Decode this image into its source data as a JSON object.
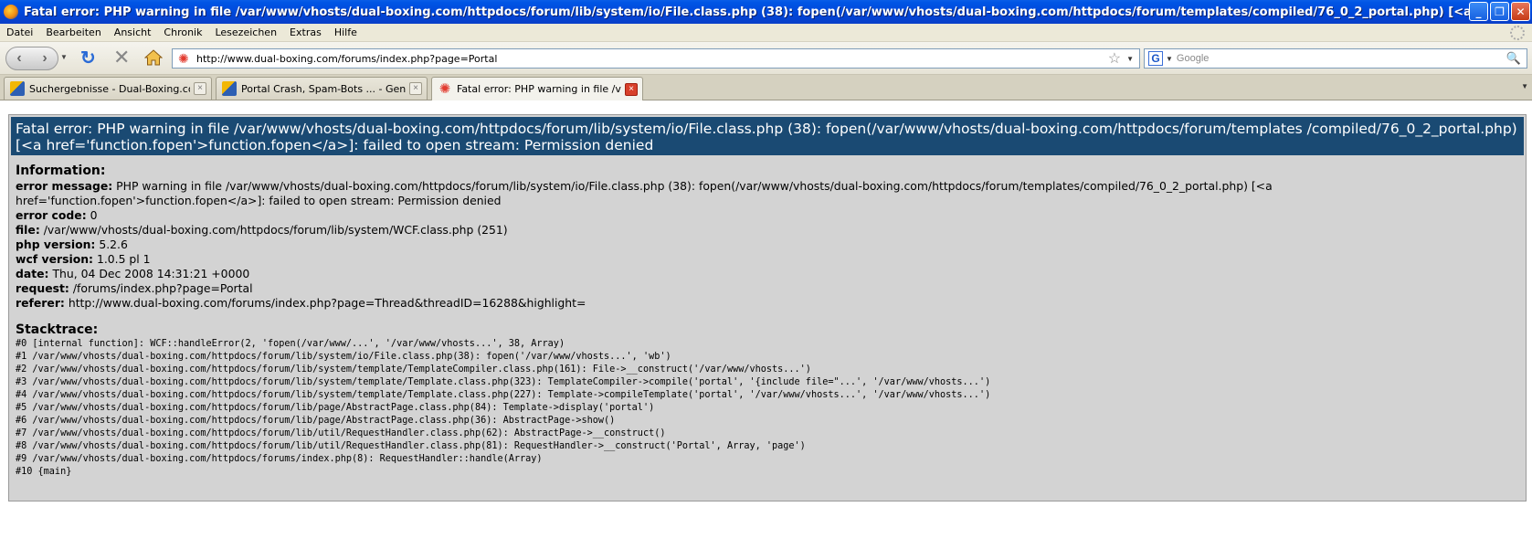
{
  "window": {
    "title": "Fatal error: PHP warning in file /var/www/vhosts/dual-boxing.com/httpdocs/forum/lib/system/io/File.class.php (38): fopen(/var/www/vhosts/dual-boxing.com/httpdocs/forum/templates/compiled/76_0_2_portal.php) [<a href='function.fopen'>function.f...",
    "minimize": "_",
    "maximize": "❐",
    "close": "✕"
  },
  "menu": [
    "Datei",
    "Bearbeiten",
    "Ansicht",
    "Chronik",
    "Lesezeichen",
    "Extras",
    "Hilfe"
  ],
  "nav": {
    "back": "‹",
    "forward": "›",
    "url": "http://www.dual-boxing.com/forums/index.php?page=Portal",
    "search_engine_letter": "G",
    "search_placeholder": "Google"
  },
  "tabs": [
    {
      "label": "Suchergebnisse - Dual-Boxing.com Com...",
      "icon": "wbb-forum-icon",
      "active": false
    },
    {
      "label": "Portal Crash, Spam-Bots ... - General D...",
      "icon": "wbb-forum-icon",
      "active": false
    },
    {
      "label": "Fatal error: PHP warning in file /v...",
      "icon": "error-site-icon",
      "active": true
    }
  ],
  "error": {
    "heading": "Fatal error: PHP warning in file /var/www/vhosts/dual-boxing.com/httpdocs/forum/lib/system/io/File.class.php (38): fopen(/var/www/vhosts/dual-boxing.com/httpdocs/forum/templates /compiled/76_0_2_portal.php) [<a href='function.fopen'>function.fopen</a>]: failed to open stream: Permission denied",
    "info_title": "Information:",
    "fields": [
      {
        "label": "error message:",
        "value": "PHP warning in file /var/www/vhosts/dual-boxing.com/httpdocs/forum/lib/system/io/File.class.php (38): fopen(/var/www/vhosts/dual-boxing.com/httpdocs/forum/templates/compiled/76_0_2_portal.php) [<a href='function.fopen'>function.fopen</a>]: failed to open stream: Permission denied"
      },
      {
        "label": "error code:",
        "value": "0"
      },
      {
        "label": "file:",
        "value": "/var/www/vhosts/dual-boxing.com/httpdocs/forum/lib/system/WCF.class.php (251)"
      },
      {
        "label": "php version:",
        "value": "5.2.6"
      },
      {
        "label": "wcf version:",
        "value": "1.0.5 pl 1"
      },
      {
        "label": "date:",
        "value": "Thu, 04 Dec 2008 14:31:21 +0000"
      },
      {
        "label": "request:",
        "value": "/forums/index.php?page=Portal"
      },
      {
        "label": "referer:",
        "value": "http://www.dual-boxing.com/forums/index.php?page=Thread&threadID=16288&highlight="
      }
    ],
    "stack_title": "Stacktrace:",
    "stack": [
      "#0 [internal function]: WCF::handleError(2, 'fopen(/var/www/...', '/var/www/vhosts...', 38, Array)",
      "#1 /var/www/vhosts/dual-boxing.com/httpdocs/forum/lib/system/io/File.class.php(38): fopen('/var/www/vhosts...', 'wb')",
      "#2 /var/www/vhosts/dual-boxing.com/httpdocs/forum/lib/system/template/TemplateCompiler.class.php(161): File->__construct('/var/www/vhosts...')",
      "#3 /var/www/vhosts/dual-boxing.com/httpdocs/forum/lib/system/template/Template.class.php(323): TemplateCompiler->compile('portal', '{include file=\"...', '/var/www/vhosts...')",
      "#4 /var/www/vhosts/dual-boxing.com/httpdocs/forum/lib/system/template/Template.class.php(227): Template->compileTemplate('portal', '/var/www/vhosts...', '/var/www/vhosts...')",
      "#5 /var/www/vhosts/dual-boxing.com/httpdocs/forum/lib/page/AbstractPage.class.php(84): Template->display('portal')",
      "#6 /var/www/vhosts/dual-boxing.com/httpdocs/forum/lib/page/AbstractPage.class.php(36): AbstractPage->show()",
      "#7 /var/www/vhosts/dual-boxing.com/httpdocs/forum/lib/util/RequestHandler.class.php(62): AbstractPage->__construct()",
      "#8 /var/www/vhosts/dual-boxing.com/httpdocs/forum/lib/util/RequestHandler.class.php(81): RequestHandler->__construct('Portal', Array, 'page')",
      "#9 /var/www/vhosts/dual-boxing.com/httpdocs/forums/index.php(8): RequestHandler::handle(Array)",
      "#10 {main}"
    ]
  }
}
